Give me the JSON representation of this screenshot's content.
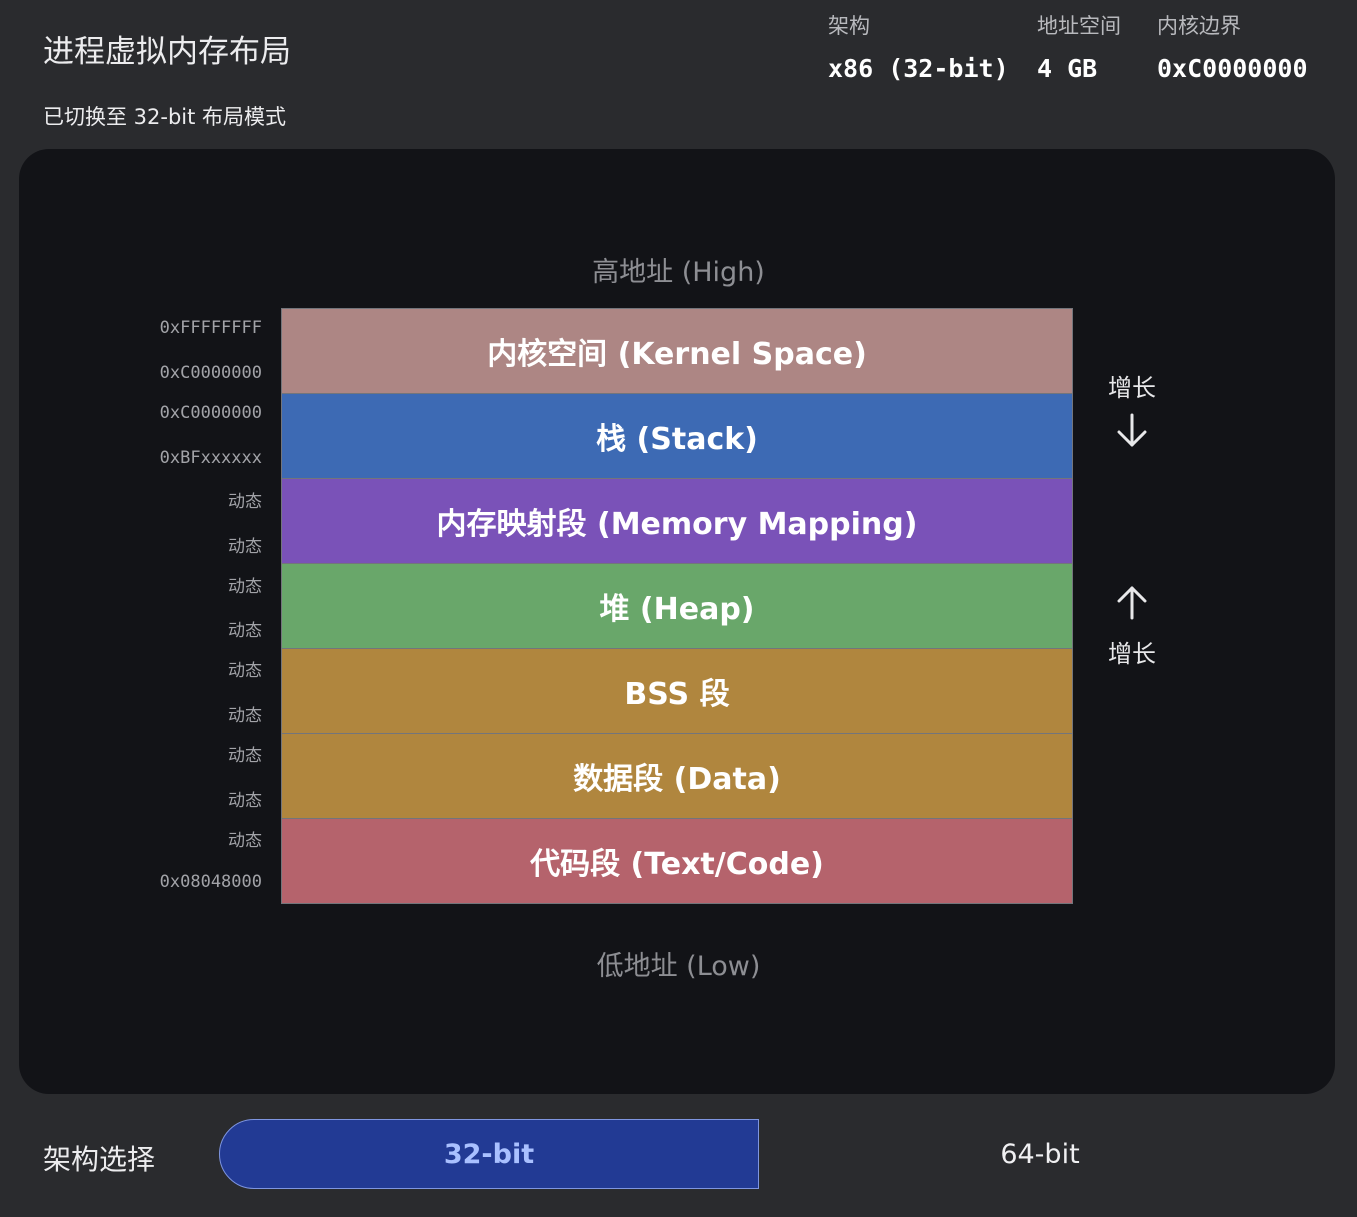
{
  "header": {
    "title": "进程虚拟内存布局",
    "subtitle": "已切换至 32-bit 布局模式"
  },
  "stats": [
    {
      "label": "架构",
      "value": "x86 (32-bit)"
    },
    {
      "label": "地址空间",
      "value": "4 GB"
    },
    {
      "label": "内核边界",
      "value": "0xC0000000"
    }
  ],
  "diagram": {
    "high_label": "高地址 (High)",
    "low_label": "低地址 (Low)",
    "segments": [
      {
        "name": "内核空间 (Kernel Space)",
        "color": "#ad8684",
        "addr_top": "0xFFFFFFFF",
        "addr_bottom": "0xC0000000"
      },
      {
        "name": "栈 (Stack)",
        "color": "#3d6ab4",
        "addr_top": "0xC0000000",
        "addr_bottom": "0xBFxxxxxx"
      },
      {
        "name": "内存映射段 (Memory Mapping)",
        "color": "#7a52b8",
        "addr_top": "动态",
        "addr_bottom": "动态"
      },
      {
        "name": "堆 (Heap)",
        "color": "#69a76a",
        "addr_top": "动态",
        "addr_bottom": "动态"
      },
      {
        "name": "BSS 段",
        "color": "#b0863e",
        "addr_top": "动态",
        "addr_bottom": "动态"
      },
      {
        "name": "数据段 (Data)",
        "color": "#b0863e",
        "addr_top": "动态",
        "addr_bottom": "动态"
      },
      {
        "name": "代码段 (Text/Code)",
        "color": "#b5636c",
        "addr_top": "动态",
        "addr_bottom": "0x08048000"
      }
    ],
    "stack_growth": {
      "label": "增长",
      "icon": "arrow-down-icon"
    },
    "heap_growth": {
      "label": "增长",
      "icon": "arrow-up-icon"
    }
  },
  "arch_selector": {
    "label": "架构选择",
    "options": [
      "32-bit",
      "64-bit"
    ],
    "selected": "32-bit"
  }
}
